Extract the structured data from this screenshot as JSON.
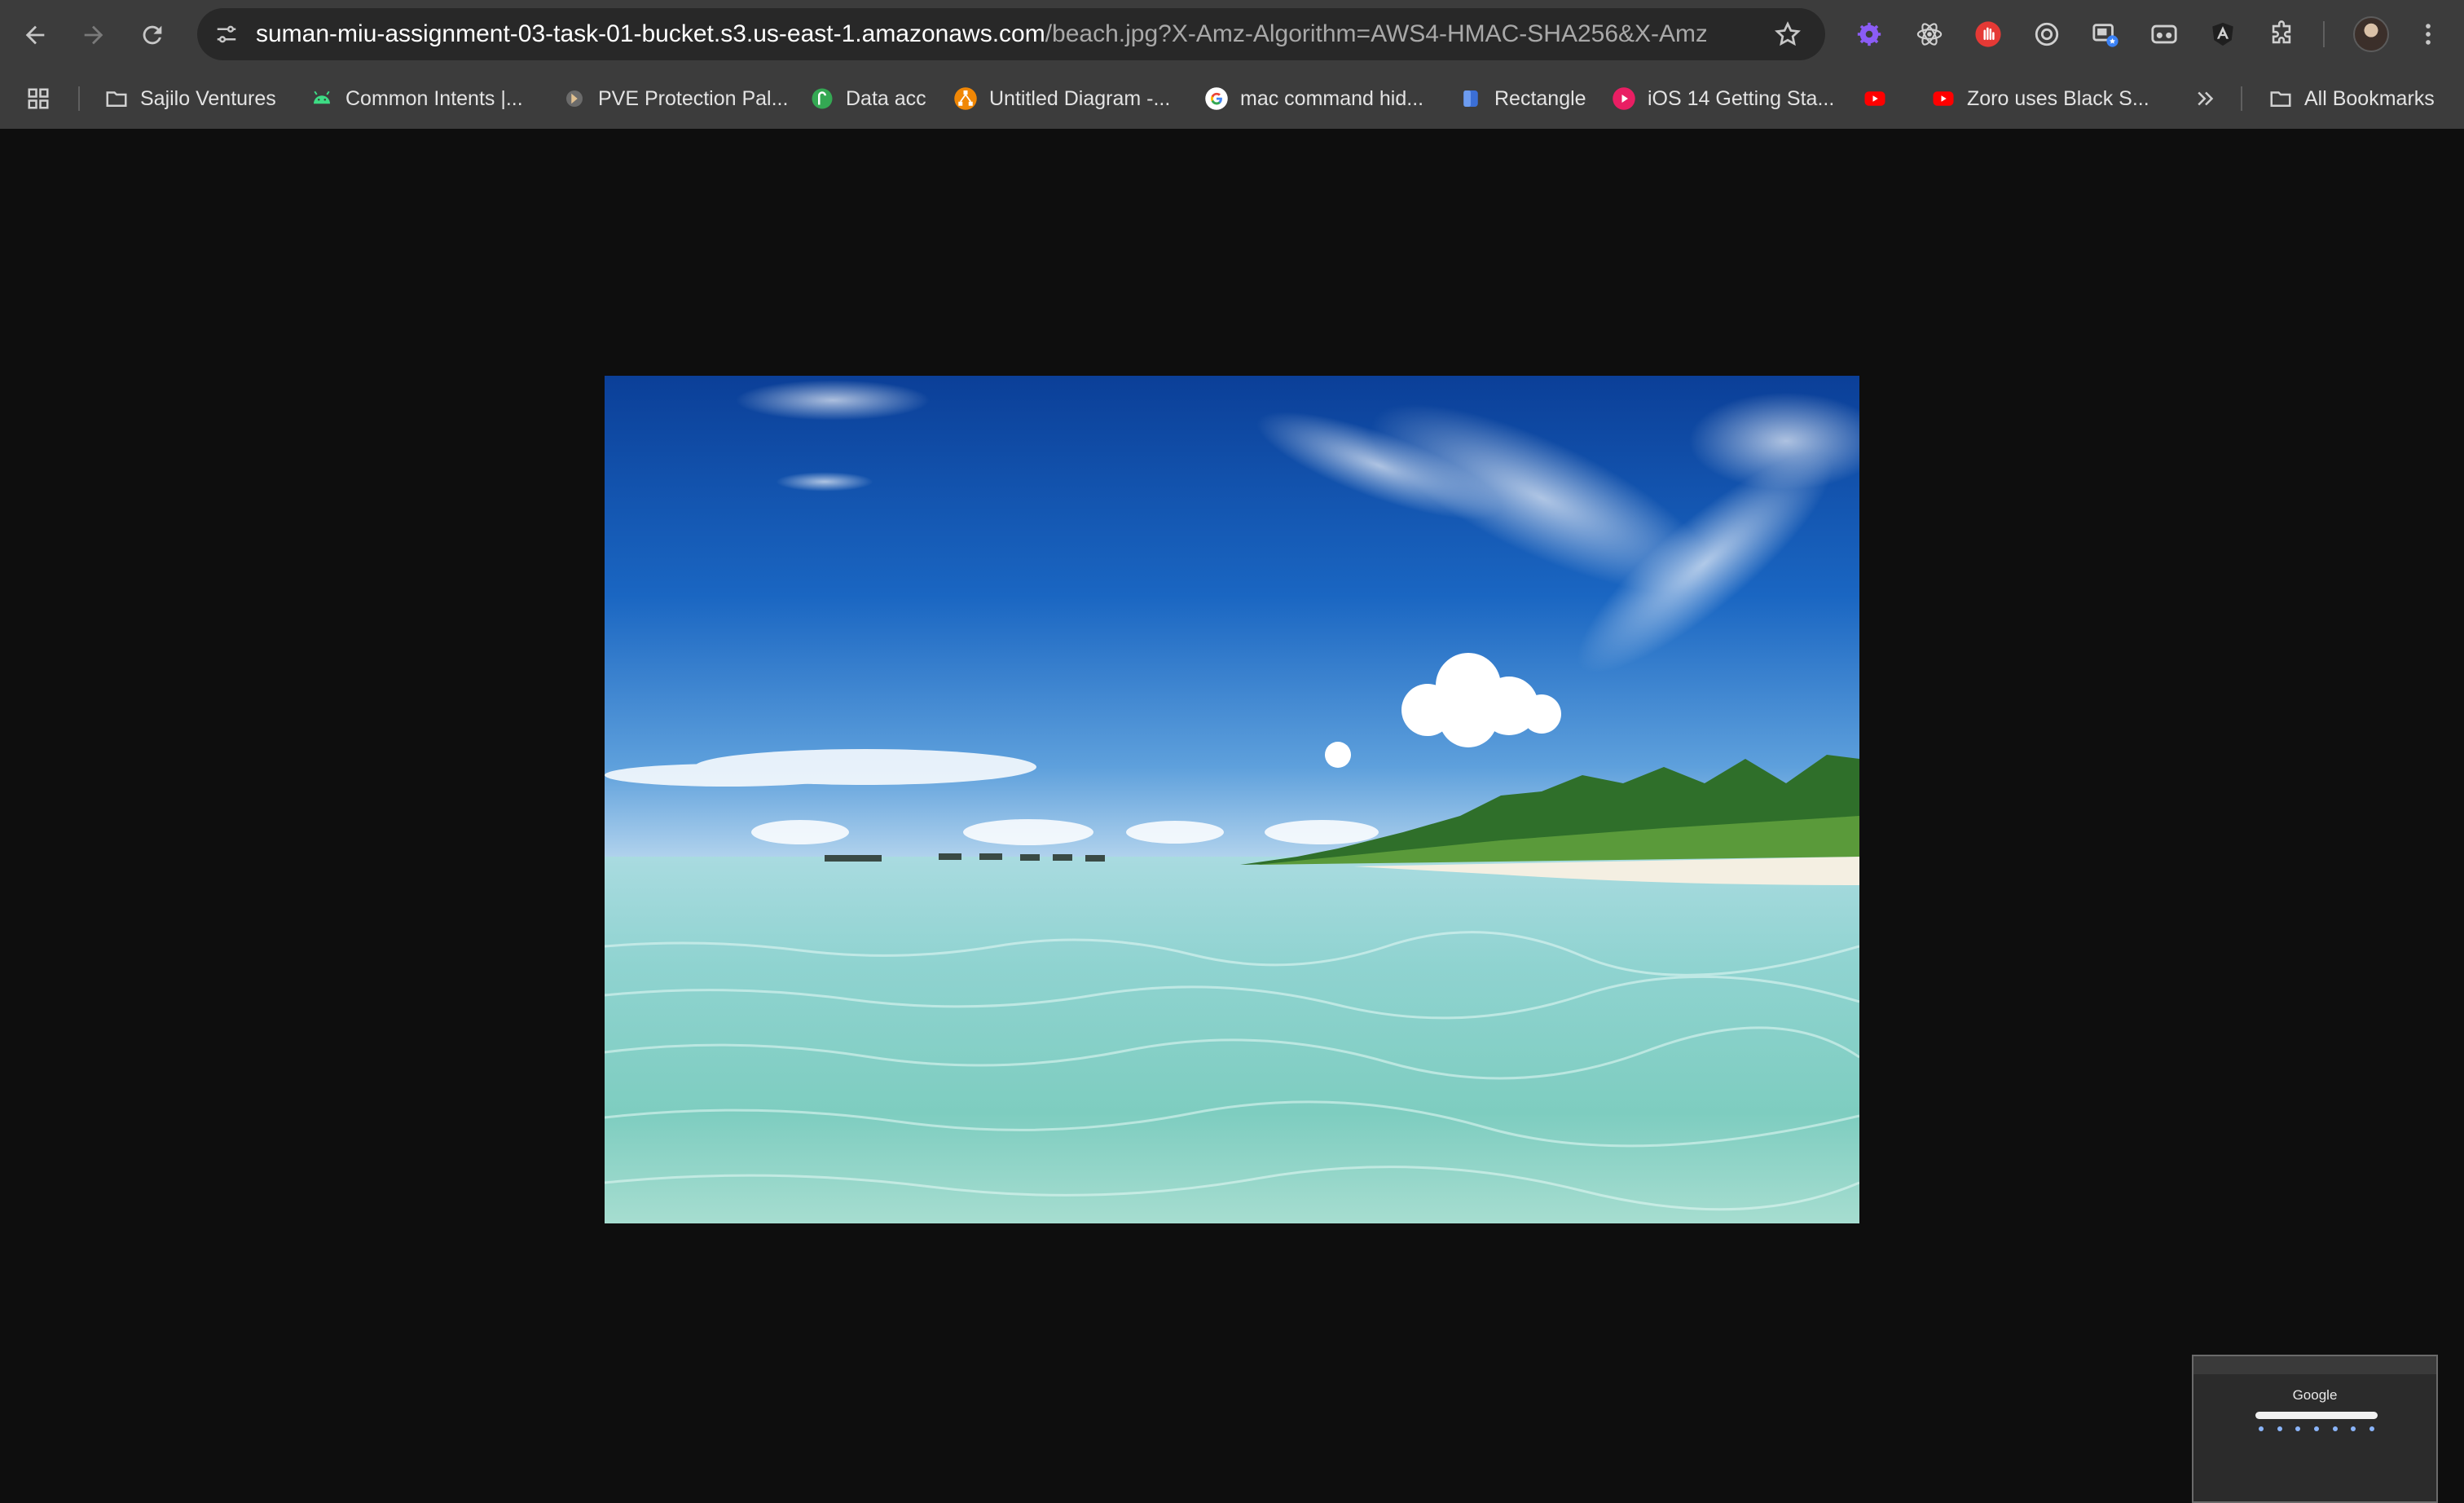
{
  "browser": {
    "url_host": "suman-miu-assignment-03-task-01-bucket.s3.us-east-1.amazonaws.com",
    "url_path": "/beach.jpg?X-Amz-Algorithm=AWS4-HMAC-SHA256&X-Amz-..."
  },
  "bookmarks": {
    "items": [
      {
        "label": "Sajilo Ventures",
        "icon": "folder-icon"
      },
      {
        "label": "Common Intents |...",
        "icon": "android-icon"
      },
      {
        "label": "PVE Protection Pal...",
        "icon": "pve-icon"
      },
      {
        "label": "Data acc",
        "icon": "green-app-icon"
      },
      {
        "label": "Untitled Diagram -...",
        "icon": "drawio-icon"
      },
      {
        "label": "mac command hid...",
        "icon": "google-icon"
      },
      {
        "label": "Rectangle",
        "icon": "rectangle-app-icon"
      },
      {
        "label": "iOS 14 Getting Sta...",
        "icon": "ios-video-icon"
      },
      {
        "label": "",
        "icon": "youtube-icon"
      },
      {
        "label": "Zoro uses Black S...",
        "icon": "youtube-icon"
      }
    ],
    "all_label": "All Bookmarks"
  },
  "minimap": {
    "title": "Google"
  },
  "colors": {
    "page_background": "#0e0e0e",
    "toolbar": "#3c3c3c",
    "omnibox": "#282828"
  }
}
